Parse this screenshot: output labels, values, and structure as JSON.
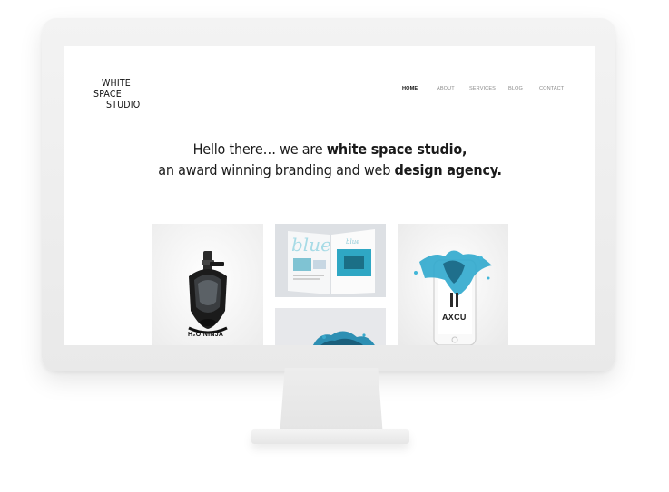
{
  "site": {
    "logo": [
      "WHITE",
      "SPACE",
      "STUDIO"
    ],
    "nav": [
      {
        "label": "HOME",
        "active": true
      },
      {
        "label": "ABOUT",
        "active": false
      },
      {
        "label": "SERVICES",
        "active": false
      },
      {
        "label": "BLOG",
        "active": false
      },
      {
        "label": "CONTACT",
        "active": false
      }
    ],
    "hero": {
      "line1_a": "Hello there… we are ",
      "line1_b": "white space studio,",
      "line2_a": "an award winning branding and web ",
      "line2_b": "design agency."
    },
    "portfolio": [
      {
        "caption": "H₂O NINJA"
      },
      {
        "caption": ""
      },
      {
        "caption": ""
      },
      {
        "caption": "AXCU"
      }
    ]
  },
  "colors": {
    "accent_blue": "#3fb6d6",
    "text": "#111111",
    "nav_muted": "#8a8a8a"
  }
}
